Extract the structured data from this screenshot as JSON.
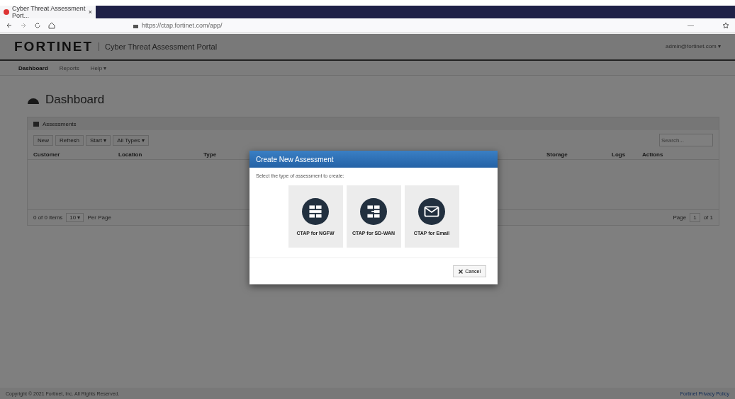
{
  "browser": {
    "tab_title": "Cyber Threat Assessment Port...",
    "close": "×",
    "url": "https://ctap.fortinet.com/app/",
    "zoom": "—"
  },
  "header": {
    "brand": "FORTINET",
    "title": "Cyber Threat Assessment Portal",
    "user": "admin@fortinet.com ▾"
  },
  "nav": [
    {
      "label": "Dashboard",
      "selected": true
    },
    {
      "label": "Reports",
      "selected": false
    },
    {
      "label": "Help ▾",
      "selected": false
    }
  ],
  "page_title": "Dashboard",
  "panel": {
    "title": "Assessments",
    "toolbar": [
      "New",
      "Refresh",
      "Start ▾",
      "All Types ▾"
    ],
    "search": {
      "placeholder": "Search..."
    },
    "columns": [
      "Customer",
      "Location",
      "Type",
      "Storage",
      "Logs",
      "Actions"
    ],
    "pager": {
      "items": "0 of 0 items",
      "per_page": "10 ▾",
      "per_page_label": "Per Page",
      "page_label": "Page",
      "page": "1",
      "of": "of 1"
    }
  },
  "modal": {
    "title": "Create New Assessment",
    "prompt": "Select the type of assessment to create:",
    "options": [
      {
        "kind": "ngfw",
        "label": "CTAP for NGFW"
      },
      {
        "kind": "sdwan",
        "label": "CTAP for SD-WAN"
      },
      {
        "kind": "email",
        "label": "CTAP for Email"
      }
    ],
    "cancel": "Cancel"
  },
  "footer": {
    "copyright": "Copyright © 2021 Fortinet, Inc. All Rights Reserved.",
    "link": "Fortinet Privacy Policy"
  }
}
